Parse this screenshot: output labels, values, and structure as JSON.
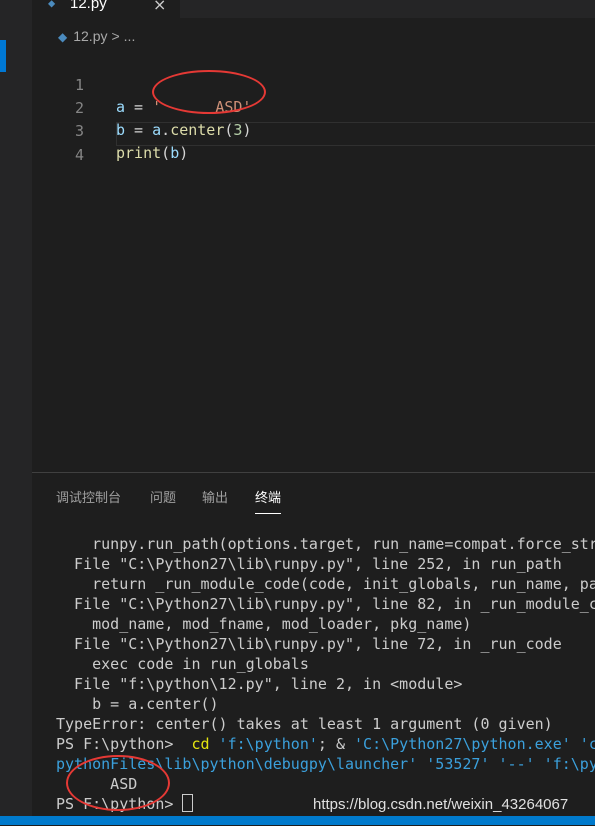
{
  "tab": {
    "title": "12.py",
    "close": "×",
    "icon": "python-file-icon"
  },
  "breadcrumb": {
    "file": "12.py",
    "separator": ">",
    "more": "..."
  },
  "editor": {
    "line_numbers": [
      "1",
      "2",
      "3",
      "4"
    ],
    "line1": {
      "var": "a",
      "eq": " = ",
      "str": "'      ASD'"
    },
    "line2": {
      "var": "b",
      "eq": " = ",
      "obj": "a",
      "dot": ".",
      "fn": "center",
      "open": "(",
      "arg": "3",
      "close": ")"
    },
    "line3": {
      "fn": "print",
      "open": "(",
      "arg": "b",
      "close": ")"
    }
  },
  "panel": {
    "tabs": [
      "调试控制台",
      "问题",
      "输出",
      "终端"
    ],
    "active_tab": "终端"
  },
  "terminal": {
    "lines": [
      "    runpy.run_path(options.target, run_name=compat.force_str",
      "  File \"C:\\Python27\\lib\\runpy.py\", line 252, in run_path",
      "    return _run_module_code(code, init_globals, run_name, pa",
      "  File \"C:\\Python27\\lib\\runpy.py\", line 82, in _run_module_c",
      "    mod_name, mod_fname, mod_loader, pkg_name)",
      "  File \"C:\\Python27\\lib\\runpy.py\", line 72, in _run_code",
      "    exec code in run_globals",
      "  File \"f:\\python\\12.py\", line 2, in <module>",
      "    b = a.center()",
      "TypeError: center() takes at least 1 argument (0 given)"
    ],
    "prompt1": "PS F:\\python> ",
    "cmd": " cd",
    "arg1": " 'f:\\python'",
    "sep": "; & ",
    "exe": "'C:\\Python27\\python.exe'",
    "exe_tail": " 'c",
    "cont": "pythonFiles\\lib\\python\\debugpy\\launcher' '53527' '--' 'f:\\py",
    "output": "      ASD",
    "prompt2": "PS F:\\python> "
  },
  "watermark": "https://blog.csdn.net/weixin_43264067",
  "colors": {
    "accent": "#007acc",
    "annotation": "#e53935"
  }
}
